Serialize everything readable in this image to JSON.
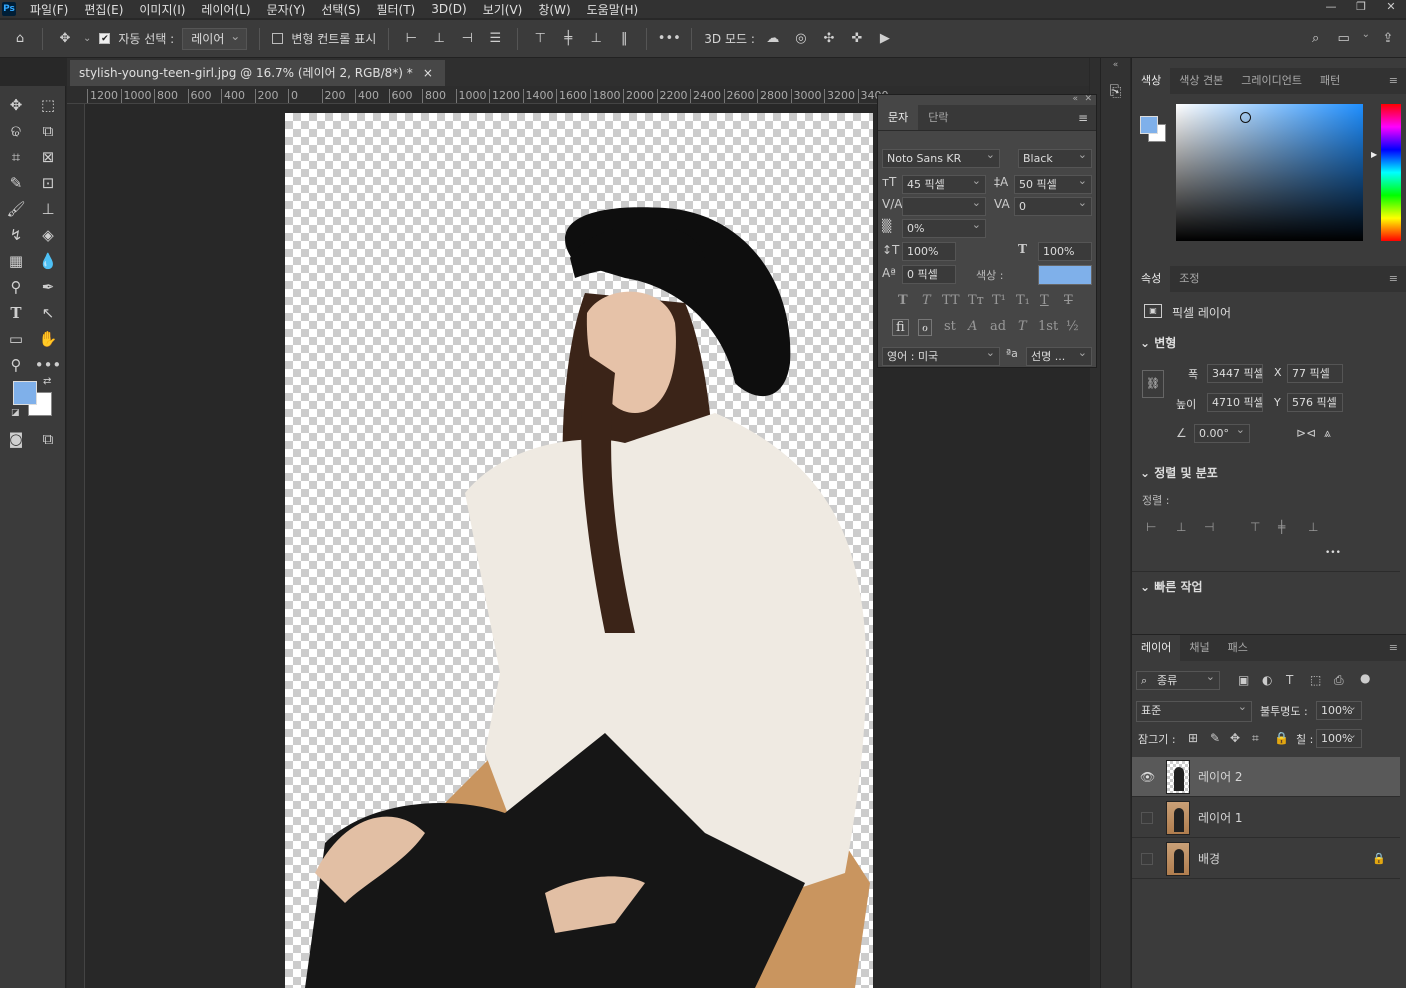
{
  "app": {
    "logo": "Ps"
  },
  "menu": [
    "파일(F)",
    "편집(E)",
    "이미지(I)",
    "레이어(L)",
    "문자(Y)",
    "선택(S)",
    "필터(T)",
    "3D(D)",
    "보기(V)",
    "창(W)",
    "도움말(H)"
  ],
  "window_controls": {
    "minimize": "—",
    "restore": "❐",
    "close": "✕"
  },
  "options": {
    "auto_select_label": "자동 선택 :",
    "auto_select_value": "레이어",
    "transform_controls_label": "변형 컨트롤 표시",
    "three_d_mode_label": "3D 모드 :"
  },
  "document": {
    "tab_title": "stylish-young-teen-girl.jpg @ 16.7% (레이어 2, RGB/8*) *",
    "close": "×"
  },
  "ruler_h": [
    "1200",
    "1000",
    "800",
    "600",
    "400",
    "200",
    "0",
    "200",
    "400",
    "600",
    "800",
    "1000",
    "1200",
    "1400",
    "1600",
    "1800",
    "2000",
    "2200",
    "2400",
    "2600",
    "2800",
    "3000",
    "3200",
    "3400"
  ],
  "character_panel": {
    "tabs": [
      "문자",
      "단락"
    ],
    "font_family": "Noto Sans KR",
    "font_style": "Black",
    "font_size": "45 픽셀",
    "leading": "50 픽셀",
    "kerning": "",
    "tracking": "0",
    "scale_percent": "0%",
    "vertical_scale": "100%",
    "horizontal_scale": "100%",
    "baseline_shift": "0 픽셀",
    "color_label": "색상 :",
    "color": "#7fb0ea",
    "language": "영어 : 미국",
    "aa_label": "ªa",
    "antialias": "선명 ..."
  },
  "color_panel": {
    "tabs": [
      "색상",
      "색상 견본",
      "그레이디언트",
      "패턴"
    ],
    "foreground": "#7fb0ea",
    "background": "#ffffff",
    "field_hue": "#1f8fff"
  },
  "properties_panel": {
    "tabs": [
      "속성",
      "조정"
    ],
    "layer_type": "픽셀 레이어",
    "transform_header": "변형",
    "w_label": "폭",
    "w": "3447 픽셀",
    "x_label": "X",
    "x": "77 픽셀",
    "h_label": "높이",
    "h": "4710 픽셀",
    "y_label": "Y",
    "y": "576 픽셀",
    "angle": "0.00°",
    "align_header": "정렬 및 분포",
    "align_label": "정렬 :",
    "more": "•••",
    "quick_header": "빠른 작업"
  },
  "layers_panel": {
    "tabs": [
      "레이어",
      "채널",
      "패스"
    ],
    "filter_kind": "종류",
    "blend_mode": "표준",
    "opacity_label": "불투명도 :",
    "opacity": "100%",
    "lock_label": "잠그기 :",
    "fill_label": "칠 :",
    "fill": "100%",
    "layers": [
      {
        "name": "레이어 2",
        "visible": true,
        "selected": true
      },
      {
        "name": "레이어 1",
        "visible": false,
        "selected": false
      },
      {
        "name": "배경",
        "visible": false,
        "selected": false,
        "locked": true
      }
    ]
  }
}
